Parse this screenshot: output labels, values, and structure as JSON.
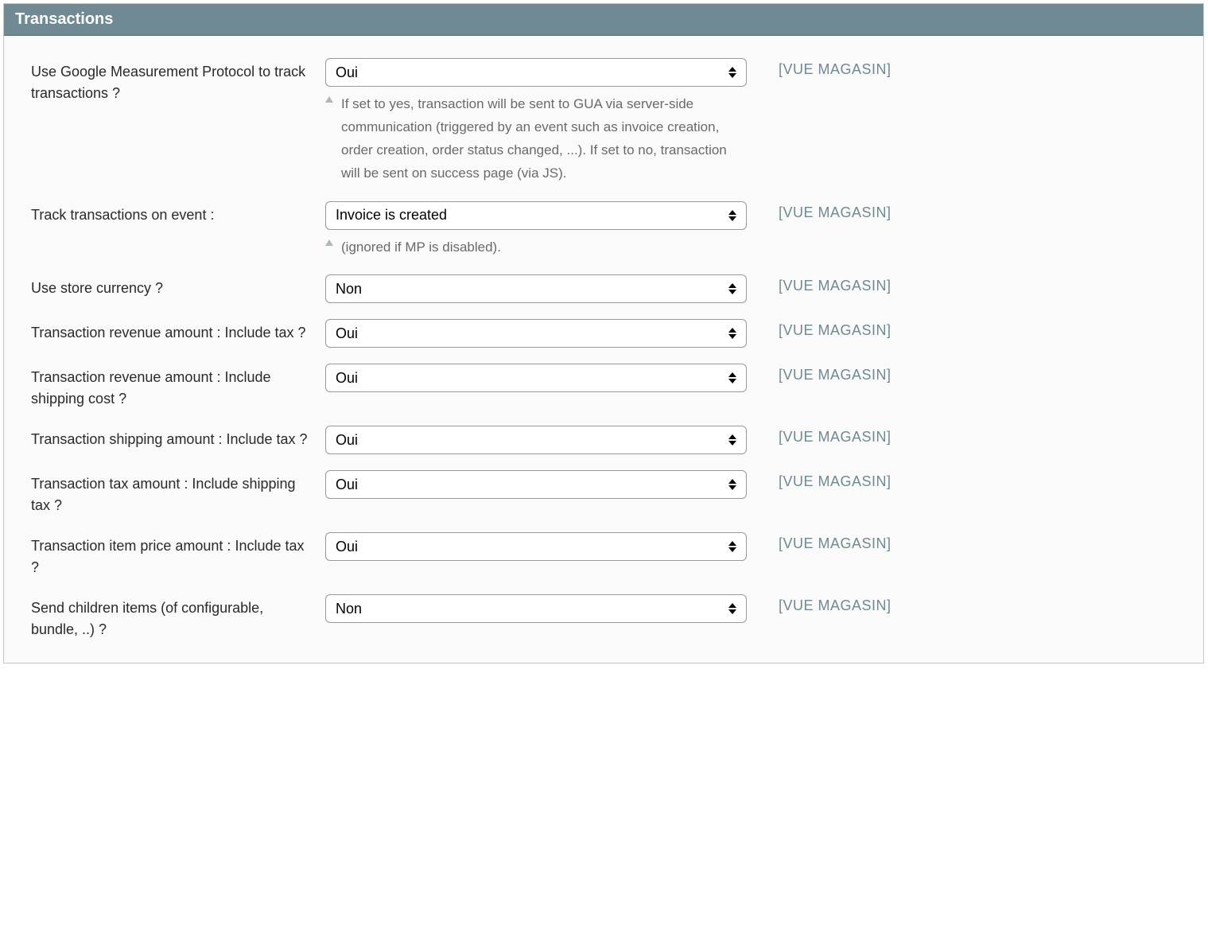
{
  "panel": {
    "title": "Transactions",
    "scope_label": "[VUE MAGASIN]"
  },
  "fields": {
    "use_mp": {
      "label": "Use Google Measurement Protocol to track transactions ?",
      "value": "Oui",
      "help": "If set to yes, transaction will be sent to GUA via server-side communication (triggered by an event such as invoice creation, order creation, order status changed, ...). If set to no, transaction will be sent on success page (via JS)."
    },
    "track_event": {
      "label": "Track transactions on event :",
      "value": "Invoice is created",
      "help": "(ignored if MP is disabled)."
    },
    "use_store_currency": {
      "label": "Use store currency ?",
      "value": "Non"
    },
    "revenue_include_tax": {
      "label": "Transaction revenue amount : Include tax ?",
      "value": "Oui"
    },
    "revenue_include_shipping": {
      "label": "Transaction revenue amount : Include shipping cost ?",
      "value": "Oui"
    },
    "shipping_include_tax": {
      "label": "Transaction shipping amount : Include tax ?",
      "value": "Oui"
    },
    "tax_include_shipping_tax": {
      "label": "Transaction tax amount : Include shipping tax ?",
      "value": "Oui"
    },
    "item_price_include_tax": {
      "label": "Transaction item price amount : Include tax ?",
      "value": "Oui"
    },
    "send_children": {
      "label": "Send children items (of configurable, bundle, ..) ?",
      "value": "Non"
    }
  }
}
